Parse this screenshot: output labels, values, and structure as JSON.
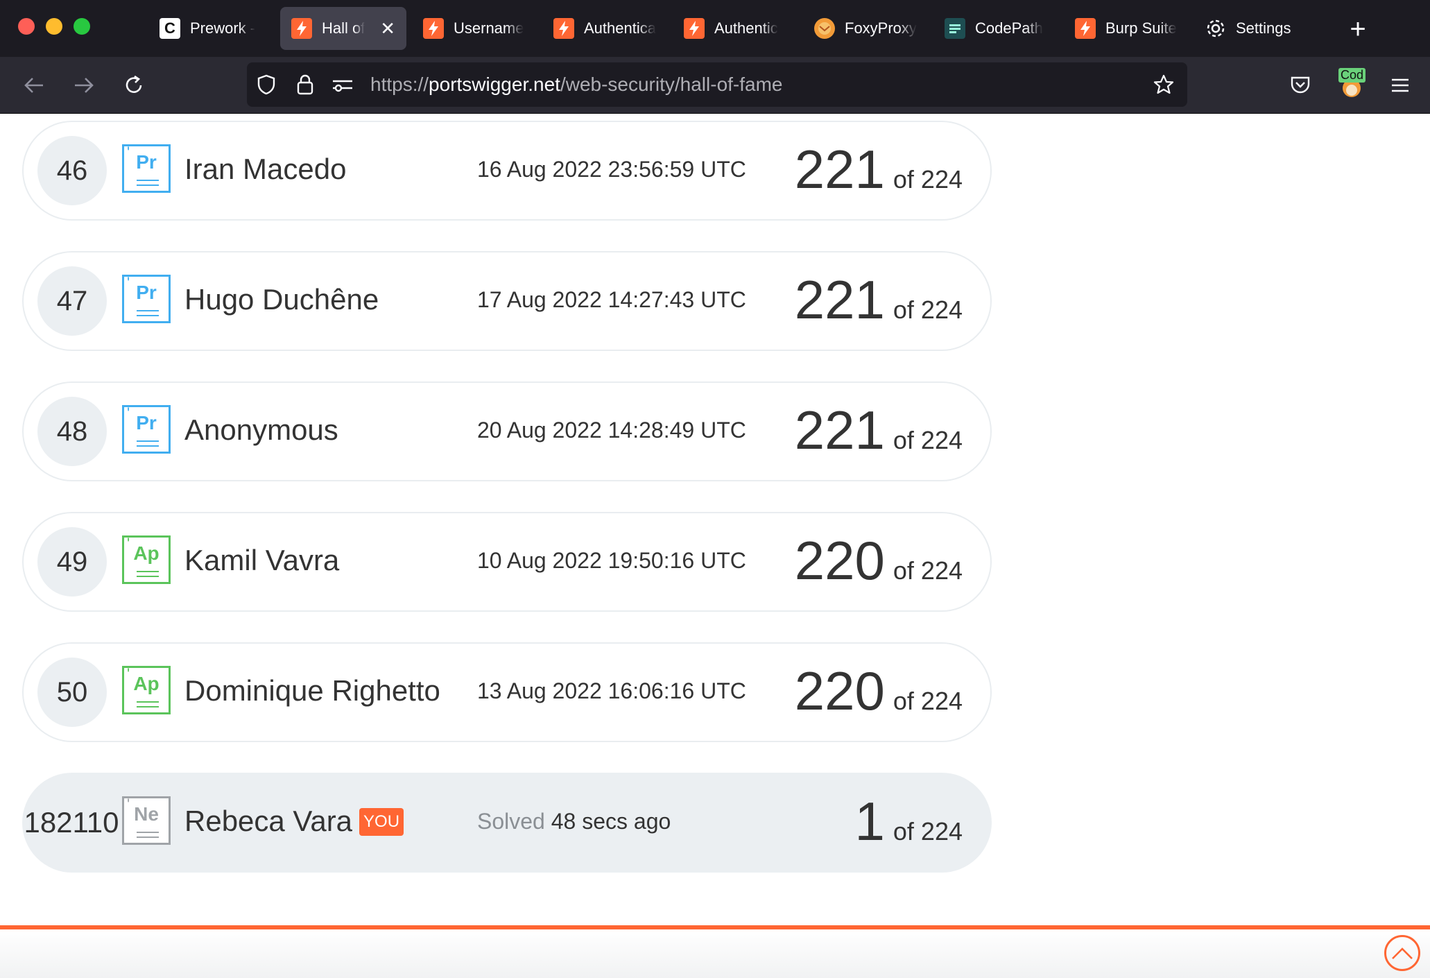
{
  "browser": {
    "tabs": [
      {
        "label": "Prework -",
        "icon": "codepath-c-icon",
        "active": false
      },
      {
        "label": "Hall of",
        "icon": "portswigger-icon",
        "active": true
      },
      {
        "label": "Username",
        "icon": "portswigger-icon",
        "active": false
      },
      {
        "label": "Authentica",
        "icon": "portswigger-icon",
        "active": false
      },
      {
        "label": "Authentic",
        "icon": "portswigger-icon",
        "active": false
      },
      {
        "label": "FoxyProxy",
        "icon": "foxyproxy-icon",
        "active": false
      },
      {
        "label": "CodePath",
        "icon": "codepath-icon",
        "active": false
      },
      {
        "label": "Burp Suite",
        "icon": "portswigger-icon",
        "active": false
      },
      {
        "label": "Settings",
        "icon": "gear-icon",
        "active": false
      }
    ],
    "url": {
      "scheme": "https://",
      "host": "portswigger.net",
      "path": "/web-security/hall-of-fame"
    },
    "extension_label": "Cod"
  },
  "leaderboard": {
    "total": "224",
    "of_prefix": "of",
    "entries": [
      {
        "rank": "46",
        "badge": "Pr",
        "name": "Iran Macedo",
        "date": "16 Aug 2022 23:56:59 UTC",
        "solved": "221"
      },
      {
        "rank": "47",
        "badge": "Pr",
        "name": "Hugo Duchêne",
        "date": "17 Aug 2022 14:27:43 UTC",
        "solved": "221"
      },
      {
        "rank": "48",
        "badge": "Pr",
        "name": "Anonymous",
        "date": "20 Aug 2022 14:28:49 UTC",
        "solved": "221"
      },
      {
        "rank": "49",
        "badge": "Ap",
        "name": "Kamil Vavra",
        "date": "10 Aug 2022 19:50:16 UTC",
        "solved": "220"
      },
      {
        "rank": "50",
        "badge": "Ap",
        "name": "Dominique Righetto",
        "date": "13 Aug 2022 16:06:16 UTC",
        "solved": "220"
      }
    ],
    "current_user": {
      "rank": "182110",
      "badge": "Ne",
      "name": "Rebeca Vara",
      "you_tag": "YOU",
      "solved_prefix": "Solved",
      "solved_time": "48 secs ago",
      "solved": "1"
    }
  },
  "colors": {
    "accent": "#ff6633",
    "badge_practitioner": "#41aef0",
    "badge_apprentice": "#5bc45b",
    "badge_new": "#a0a4a8",
    "row_border": "#e9edf0",
    "rank_bg": "#ebeff2"
  }
}
